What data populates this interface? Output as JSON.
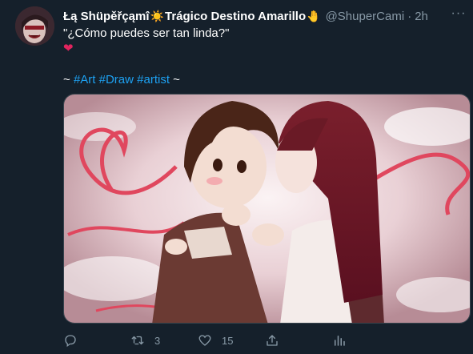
{
  "tweet": {
    "display_name": "Łą Shüpěřçąmî",
    "emoji_sun": "☀️",
    "display_name_2": "Trágico Destino Amarillo",
    "emoji_hand": "🤚",
    "handle": "@ShuperCami",
    "separator": "·",
    "time": "2h",
    "more_label": "···",
    "text": "\"¿Cómo puedes ser tan linda?\"",
    "heart": "❤",
    "tags_prefix": "~ ",
    "hashtags": [
      "#Art",
      "#Draw",
      "#artist"
    ],
    "tags_suffix": " ~"
  },
  "actions": {
    "reply_count": "",
    "retweet_count": "3",
    "like_count": "15"
  },
  "colors": {
    "background": "#15202b",
    "muted": "#8899a6",
    "link": "#1da1f2",
    "heart": "#e0245e"
  }
}
